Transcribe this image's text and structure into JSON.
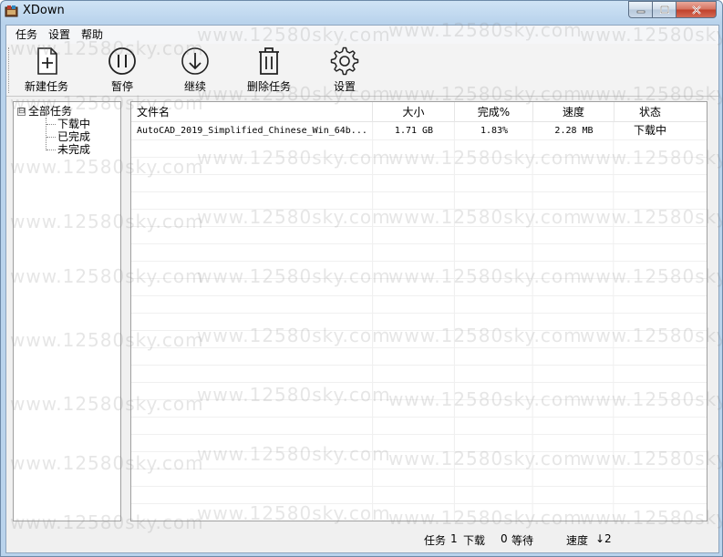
{
  "window": {
    "title": "XDown"
  },
  "menu": {
    "items": [
      "任务",
      "设置",
      "帮助"
    ]
  },
  "toolbar": {
    "new_task": "新建任务",
    "pause": "暂停",
    "resume": "继续",
    "delete_task": "删除任务",
    "settings": "设置"
  },
  "tree": {
    "root": "全部任务",
    "expander": "⊟",
    "children": [
      "下载中",
      "已完成",
      "未完成"
    ]
  },
  "list": {
    "columns": [
      "文件名",
      "大小",
      "完成%",
      "速度",
      "状态"
    ],
    "rows": [
      {
        "filename": "AutoCAD_2019_Simplified_Chinese_Win_64b...",
        "size": "1.71 GB",
        "percent": "1.83%",
        "speed": "2.28 MB",
        "status": "下载中"
      }
    ]
  },
  "statusbar": {
    "tasks_label": "任务",
    "tasks_count": "1",
    "downloading_label": "下载",
    "waiting_count": "0",
    "waiting_label": "等待",
    "speed_label": "速度",
    "speed_value": "↓2"
  },
  "watermark": "www.12580sky.com",
  "colors": {
    "titlebar": "#b9d3ec",
    "close_button": "#c0402a",
    "panel_bg": "#f0f0f0"
  }
}
